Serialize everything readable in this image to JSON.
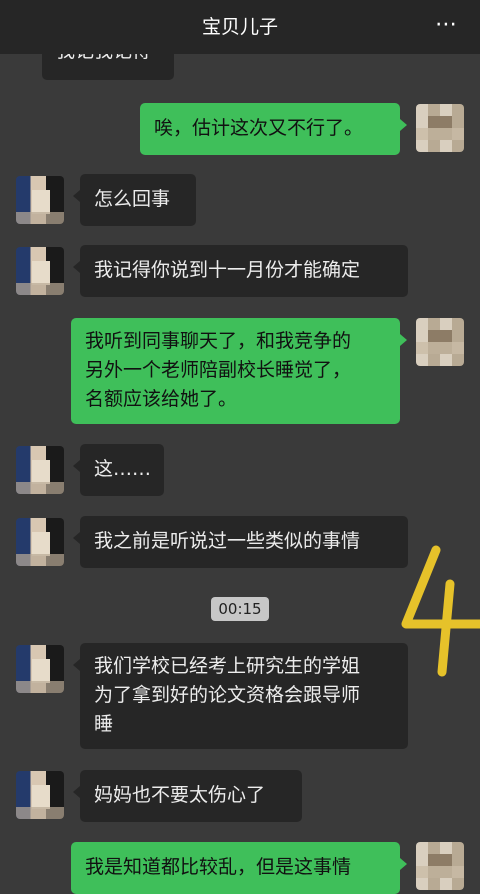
{
  "header": {
    "title": "宝贝儿子",
    "more_icon": "⋯"
  },
  "messages": [
    {
      "side": "in",
      "text": "我记我记得"
    },
    {
      "side": "out",
      "text": "唉，估计这次又不行了。"
    },
    {
      "side": "in",
      "text": "怎么回事"
    },
    {
      "side": "in",
      "text": "我记得你说到十一月份才能确定"
    },
    {
      "side": "out",
      "lines": [
        "我听到同事聊天了，和我竞争的",
        "另外一个老师陪副校长睡觉了，",
        "名额应该给她了。"
      ]
    },
    {
      "side": "in",
      "text": "这……"
    },
    {
      "side": "in",
      "text": "我之前是听说过一些类似的事情"
    },
    {
      "side": "in",
      "lines": [
        "我们学校已经考上研究生的学姐",
        "为了拿到好的论文资格会跟导师",
        "睡"
      ]
    },
    {
      "side": "in",
      "text": "妈妈也不要太伤心了"
    },
    {
      "side": "out",
      "text": "我是知道都比较乱，但是这事情"
    }
  ],
  "timestamp": "00:15",
  "colors": {
    "background": "#3a3a3a",
    "incoming": "#262626",
    "outgoing": "#3fbf5a",
    "annotation": "#e6c22a"
  },
  "annotation_mark": "4"
}
